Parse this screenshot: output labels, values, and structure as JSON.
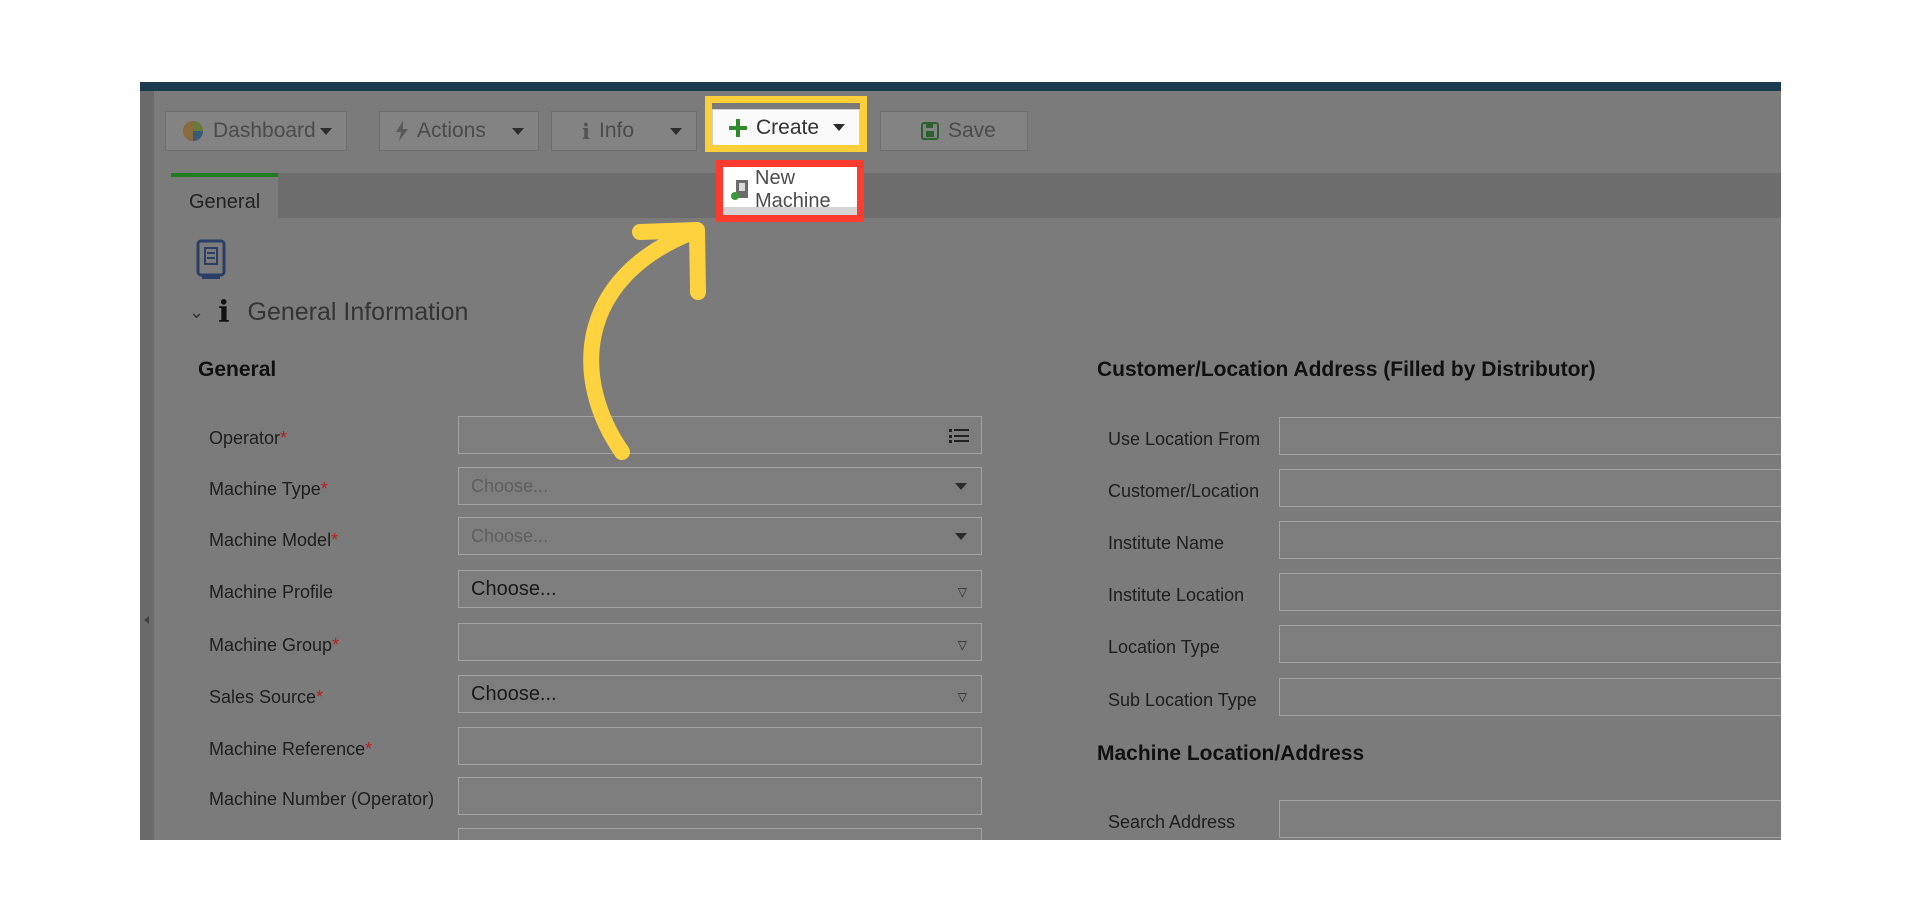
{
  "toolbar": {
    "dashboard": "Dashboard",
    "actions": "Actions",
    "info": "Info",
    "create": "Create",
    "save": "Save"
  },
  "create_menu": {
    "new_machine": "New Machine"
  },
  "tabs": {
    "general": "General"
  },
  "section": {
    "title": "General Information"
  },
  "left": {
    "heading": "General",
    "fields": [
      {
        "label": "Operator",
        "required": "*",
        "value": ""
      },
      {
        "label": "Machine Type",
        "required": "*",
        "value": "Choose..."
      },
      {
        "label": "Machine Model",
        "required": "*",
        "value": "Choose..."
      },
      {
        "label": "Machine Profile",
        "required": "",
        "value": "Choose..."
      },
      {
        "label": "Machine Group",
        "required": "*",
        "value": ""
      },
      {
        "label": "Sales Source",
        "required": "*",
        "value": "Choose..."
      },
      {
        "label": "Machine Reference",
        "required": "*",
        "value": ""
      },
      {
        "label": "Machine Number (Operator)",
        "required": "",
        "value": ""
      }
    ]
  },
  "right": {
    "heading": "Customer/Location Address (Filled by Distributor)",
    "fields": [
      {
        "label": "Use Location From"
      },
      {
        "label": "Customer/Location"
      },
      {
        "label": "Institute Name"
      },
      {
        "label": "Institute Location"
      },
      {
        "label": "Location Type"
      },
      {
        "label": "Sub Location Type"
      }
    ],
    "heading2": "Machine Location/Address",
    "search_label": "Search Address"
  },
  "colors": {
    "highlight_yellow": "#ffcf3a",
    "highlight_red": "#ff3b2f",
    "arrow": "#ffd23f"
  }
}
